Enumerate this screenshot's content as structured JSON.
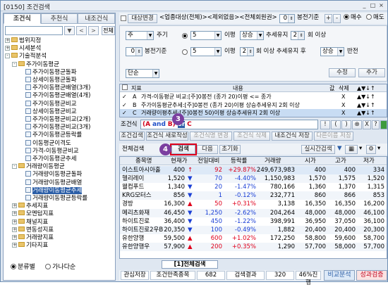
{
  "window": {
    "title": "[0150] 조건검색",
    "controls": [
      "_",
      "□",
      "×"
    ]
  },
  "left": {
    "tabs": [
      "조건식",
      "추천식",
      "내조건식"
    ],
    "search_btn": "전체",
    "tree": [
      {
        "label": "범위지정",
        "exp": "+",
        "icon": "folder",
        "depth": 0
      },
      {
        "label": "시세분석",
        "exp": "+",
        "icon": "folder",
        "depth": 0
      },
      {
        "label": "기술적분석",
        "exp": "-",
        "icon": "folder",
        "depth": 0
      },
      {
        "label": "주가이동평균",
        "exp": "-",
        "icon": "folder",
        "depth": 1
      },
      {
        "label": "주가이동평균돌파",
        "icon": "doc",
        "depth": 2
      },
      {
        "label": "상세이동평균돌파",
        "icon": "doc",
        "depth": 2
      },
      {
        "label": "주가이동평균배열(3개)",
        "icon": "doc",
        "depth": 2
      },
      {
        "label": "주가이동평균배열(4개)",
        "icon": "doc",
        "depth": 2
      },
      {
        "label": "주가이동평균비교",
        "icon": "doc",
        "depth": 2
      },
      {
        "label": "상세이동평균비교",
        "icon": "doc",
        "depth": 2
      },
      {
        "label": "주가이동평균비교(2개)",
        "icon": "doc",
        "depth": 2
      },
      {
        "label": "주가이동평균비교(3개)",
        "icon": "doc",
        "depth": 2
      },
      {
        "label": "주가이동평균등락률",
        "icon": "doc",
        "depth": 2
      },
      {
        "label": "이동평균이격도",
        "icon": "doc",
        "depth": 2
      },
      {
        "label": "가격-이동평균비교",
        "icon": "doc",
        "depth": 2
      },
      {
        "label": "주가이동평균추세",
        "icon": "doc",
        "depth": 2
      },
      {
        "label": "거래량이동평균",
        "exp": "-",
        "icon": "folder",
        "depth": 1
      },
      {
        "label": "거래량이동평균돌파",
        "icon": "doc",
        "depth": 2
      },
      {
        "label": "거래량이동평균배열",
        "icon": "doc",
        "depth": 2
      },
      {
        "label": "거래량이동평균추세",
        "icon": "doc",
        "depth": 2,
        "selected": true
      },
      {
        "label": "거래량이동평균등락률",
        "icon": "doc",
        "depth": 2
      },
      {
        "label": "추세지표",
        "exp": "+",
        "icon": "folder",
        "depth": 1
      },
      {
        "label": "모멘텀지표",
        "exp": "+",
        "icon": "folder",
        "depth": 1
      },
      {
        "label": "채널지표",
        "exp": "+",
        "icon": "folder",
        "depth": 1
      },
      {
        "label": "변동성지표",
        "exp": "+",
        "icon": "folder",
        "depth": 1
      },
      {
        "label": "거래량지표",
        "exp": "+",
        "icon": "folder",
        "depth": 1
      },
      {
        "label": "기타지표",
        "exp": "+",
        "icon": "folder",
        "depth": 1
      }
    ],
    "radio_1": "분류별",
    "radio_2": "가나다순"
  },
  "top": {
    "target_btn": "대상변경",
    "target_text": "<업종대상(전체)><제외없음><전체회원권>",
    "stock_value": "0",
    "basis_label": "봉전기준",
    "plus": "+",
    "minus": "-",
    "buy_label": "매수",
    "sell_label": "매도"
  },
  "form": {
    "period_value": "주",
    "period_unit": "주기",
    "basis_value": "0",
    "basis_unit": "봉전기준",
    "ma_period": "5",
    "ma_unit": "이평",
    "direction": "상승",
    "trend_keep": "추세유지",
    "count": "2",
    "count_unit": "회 이상",
    "ma2_period": "5",
    "ma2_unit": "이평",
    "count2": "2",
    "count2_text": "회 이상 추세유지 후",
    "direction2": "상승",
    "reverse": "반전",
    "kind": "단순",
    "modify_btn": "수정",
    "add_btn": "추가"
  },
  "cond_grid": {
    "headers": [
      "지표",
      "내용",
      "값",
      "삭제",
      "▲▼↓↑"
    ],
    "rows": [
      {
        "check": "✓",
        "id": "A",
        "content": "가격-이동평균 비교:[주]0봉전 (종가 20)이평 <= 종가",
        "x": "X",
        "arr": "▲▼↓↑"
      },
      {
        "check": "✓",
        "id": "B",
        "content": "주가이동평균추세:[주]0봉전 (종가 20)이평 상승추세유지 2회 이상",
        "x": "X",
        "arr": "▲▼↓↑"
      },
      {
        "check": "✓",
        "id": "C",
        "content": "거래량이평추세:[주]0봉전 50)이평 상승추세유지 2회 이상",
        "x": "X",
        "arr": "▲▼↓↑",
        "selected": true
      }
    ]
  },
  "condition": {
    "label": "조건식",
    "a": "(A",
    "and": "and",
    "b": "B)",
    "or": "or",
    "c": "C",
    "ops": [
      "!",
      "(",
      ")",
      "⊗",
      "X",
      "?"
    ]
  },
  "cond_buttons": [
    "조건검색",
    "조건식 새로작성",
    "조건식명 변경",
    "조건식 삭제",
    "내조건식 저장",
    "다른이름 저장"
  ],
  "searchbar": {
    "all_search": "전체검색",
    "search": "검색",
    "next": "다음",
    "reset": "초기화",
    "realtime": "실시간검색"
  },
  "callouts": {
    "c3": "3",
    "c4": "4"
  },
  "result_grid": {
    "headers": [
      "종목명",
      "현재가",
      "전일대비",
      "등락률",
      "거래량",
      "시가",
      "고가",
      "저가"
    ],
    "rows": [
      {
        "name": "이스트아시아홀",
        "price": "400",
        "arrow": "↑",
        "chg": "92",
        "pct": "+29.87%",
        "vol": "249,673,983",
        "open": "400",
        "high": "400",
        "low": "334",
        "dir": "up"
      },
      {
        "name": "헬리레이",
        "price": "1,520",
        "arrow": "▼",
        "chg": "70",
        "pct": "-4.40%",
        "vol": "1,150,983",
        "open": "1,570",
        "high": "1,575",
        "low": "1,520",
        "dir": "dn"
      },
      {
        "name": "웰컴푸드",
        "price": "1,340",
        "arrow": "▼",
        "chg": "20",
        "pct": "-1.47%",
        "vol": "780,166",
        "open": "1,360",
        "high": "1,370",
        "low": "1,315",
        "dir": "dn"
      },
      {
        "name": "KRG모터스",
        "price": "856",
        "arrow": "▼",
        "chg": "1",
        "pct": "-0.12%",
        "vol": "232,771",
        "open": "860",
        "high": "866",
        "low": "853",
        "dir": "dn"
      },
      {
        "name": "경방",
        "price": "16,300",
        "arrow": "▲",
        "chg": "50",
        "pct": "+0.31%",
        "vol": "3,138",
        "open": "16,350",
        "high": "16,350",
        "low": "16,200",
        "dir": "up"
      },
      {
        "name": "메리츠화재",
        "price": "46,450",
        "arrow": "▼",
        "chg": "1,250",
        "pct": "-2.62%",
        "vol": "204,264",
        "open": "48,000",
        "high": "48,000",
        "low": "46,100",
        "dir": "dn"
      },
      {
        "name": "하이트진로",
        "price": "36,400",
        "arrow": "▼",
        "chg": "450",
        "pct": "-1.22%",
        "vol": "398,991",
        "open": "36,950",
        "high": "37,050",
        "low": "36,100",
        "dir": "dn"
      },
      {
        "name": "하이트진로2우B",
        "price": "20,350",
        "arrow": "▼",
        "chg": "100",
        "pct": "-0.49%",
        "vol": "1,882",
        "open": "20,400",
        "high": "20,400",
        "low": "20,300",
        "dir": "dn"
      },
      {
        "name": "유한양행",
        "price": "59,500",
        "arrow": "▲",
        "chg": "600",
        "pct": "+1.02%",
        "vol": "172,250",
        "open": "58,800",
        "high": "59,600",
        "low": "58,700",
        "dir": "up"
      },
      {
        "name": "유한양행우",
        "price": "57,900",
        "arrow": "▲",
        "chg": "200",
        "pct": "+0.35%",
        "vol": "1,290",
        "open": "57,700",
        "high": "58,000",
        "low": "57,700",
        "dir": "up"
      }
    ]
  },
  "bottom_tab": "[1]전체검색",
  "status": {
    "save": "관심저장",
    "label1": "조건만족종목",
    "val1": "682",
    "label2": "검색결과",
    "val2": "320",
    "progress": "46%진행",
    "compare": "비교분석",
    "verify": "성과검증"
  }
}
